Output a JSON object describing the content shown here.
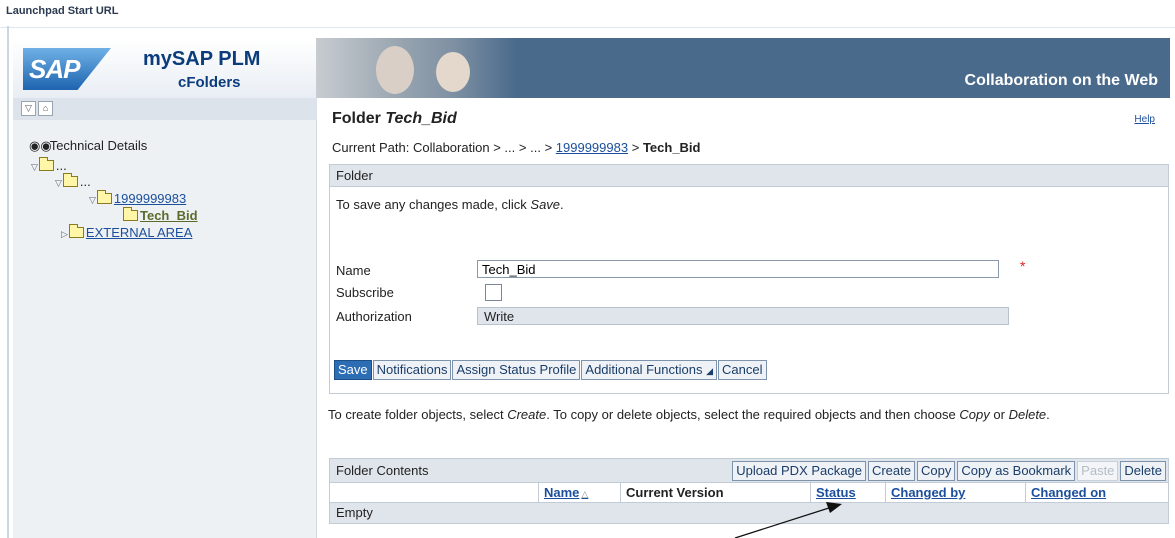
{
  "window": {
    "title": "Launchpad Start URL"
  },
  "header": {
    "logo": "SAP",
    "product_title": "mySAP PLM",
    "product_subtitle": "cFolders",
    "tagline": "Collaboration on the Web"
  },
  "leftnav": {
    "toolbar_icons": [
      "collapse-icon",
      "up-icon"
    ],
    "tree": [
      {
        "label": "Technical Details",
        "icon": "binoculars-icon"
      },
      {
        "label": "...",
        "icon": "folder-icon"
      },
      {
        "label": "...",
        "icon": "folder-icon"
      },
      {
        "label": "1999999983",
        "icon": "folder-icon"
      },
      {
        "label": "Tech_Bid",
        "icon": "folder-open-icon"
      },
      {
        "label": "EXTERNAL AREA",
        "icon": "folder-icon"
      }
    ]
  },
  "main": {
    "title_prefix": "Folder",
    "title_name": "Tech_Bid",
    "help": "Help",
    "path": {
      "prefix": "Current Path:",
      "crumbs": [
        "Collaboration",
        ">",
        "...",
        ">",
        "...",
        ">"
      ],
      "link": "1999999983",
      "sep": ">",
      "current": "Tech_Bid"
    },
    "panel": {
      "header": "Folder",
      "note_prefix": "To save any changes made, click",
      "note_em": "Save",
      "note_suffix": ".",
      "fields": {
        "name_label": "Name",
        "name_value": "Tech_Bid",
        "required_mark": "*",
        "subscribe_label": "Subscribe",
        "authorization_label": "Authorization",
        "authorization_value": "Write"
      },
      "buttons": {
        "save": "Save",
        "notifications": "Notifications",
        "assign_status_profile": "Assign Status Profile",
        "additional_functions": "Additional Functions",
        "cancel": "Cancel"
      }
    },
    "instructions": {
      "a": "To create folder objects, select",
      "b": "Create",
      "c": ". To copy or delete objects, select the required objects and then choose",
      "d": "Copy",
      "e": "or",
      "f": "Delete",
      "g": "."
    },
    "contents": {
      "header": "Folder Contents",
      "buttons": {
        "upload": "Upload PDX Package",
        "create": "Create",
        "copy": "Copy",
        "copy_bookmark": "Copy as Bookmark",
        "paste": "Paste",
        "delete": "Delete"
      },
      "columns": {
        "name": "Name",
        "current_version": "Current Version",
        "status": "Status",
        "changed_by": "Changed by",
        "changed_on": "Changed on"
      },
      "empty_text": "Empty"
    }
  },
  "colors": {
    "banner": "#4a6a8c",
    "accent": "#2c6db4",
    "link": "#1b4f9c"
  }
}
